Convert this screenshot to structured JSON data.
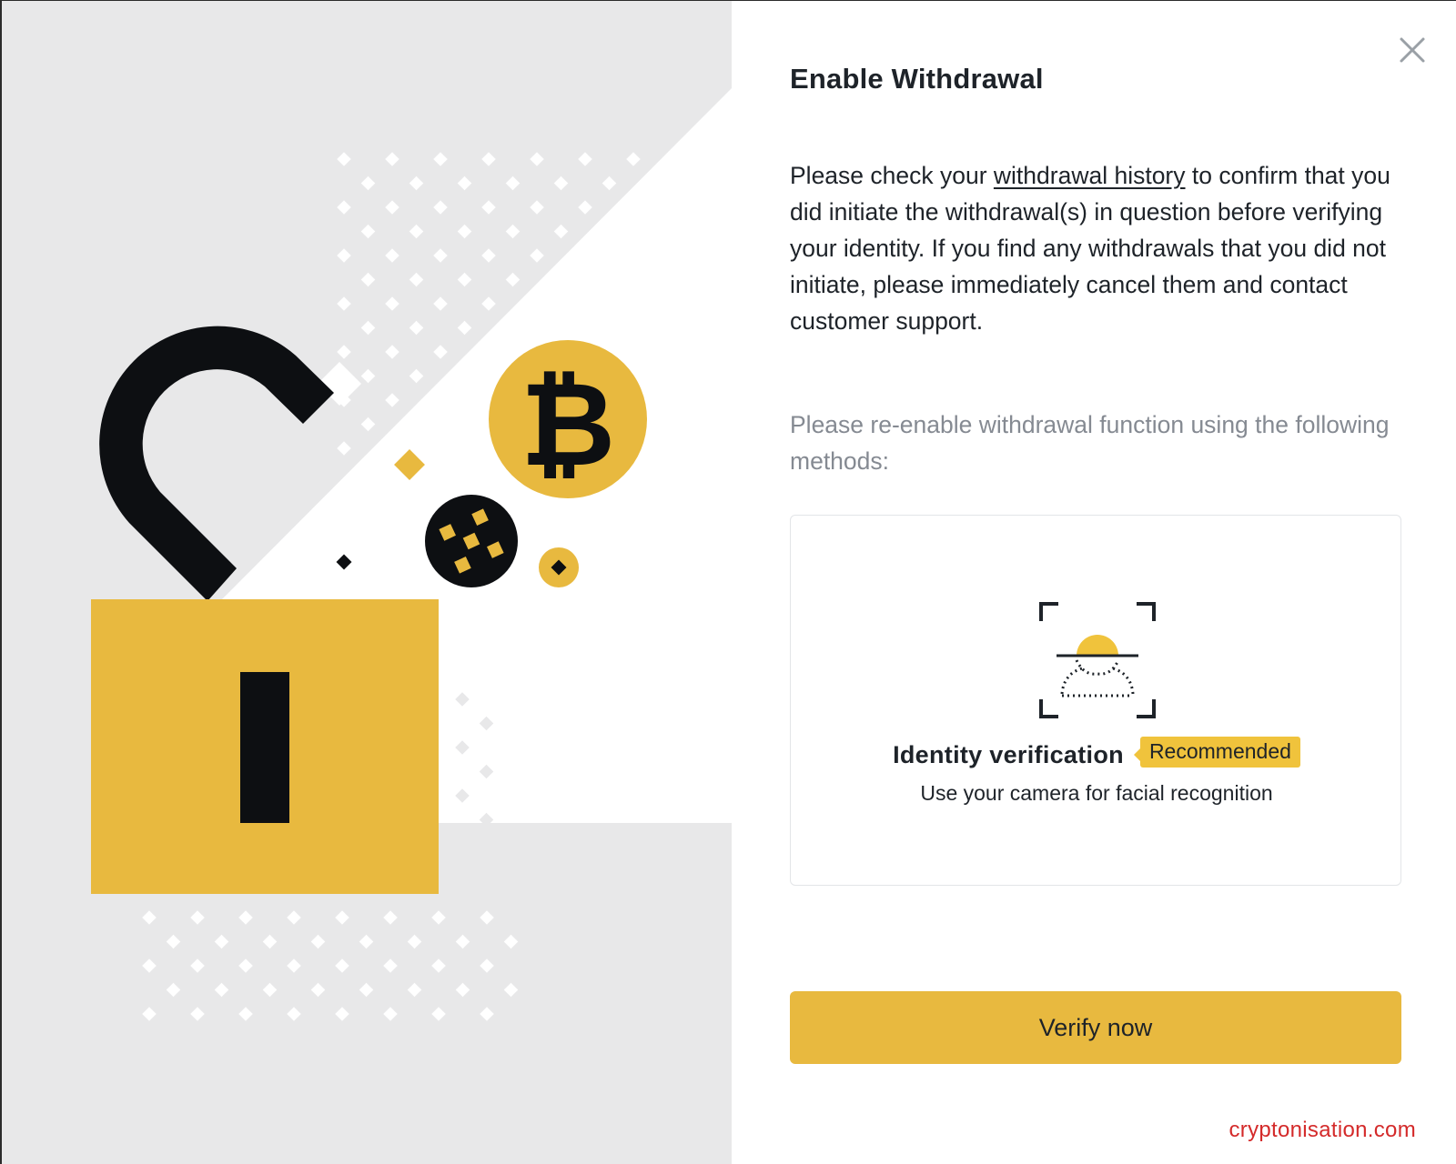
{
  "modal": {
    "title": "Enable Withdrawal",
    "close_icon": "close-icon"
  },
  "notice": {
    "before_link": "Please check your ",
    "link_text": "withdrawal history",
    "after_link": " to confirm that you did initiate the withdrawal(s) in question before verifying your identity. If you find any withdrawals that you did not initiate, please immediately cancel them and contact customer support."
  },
  "methods": {
    "intro": "Please re-enable withdrawal function using the following methods:",
    "items": [
      {
        "icon": "face-scan-icon",
        "title": "Identity verification",
        "badge": "Recommended",
        "description": "Use your camera for facial recognition"
      }
    ]
  },
  "verify_button": {
    "label": "Verify now"
  },
  "watermark": "cryptonisation.com",
  "illustration": {
    "icons": [
      "padlock-icon",
      "bitcoin-icon",
      "binance-icon"
    ]
  },
  "colors": {
    "accent": "#e8b93f",
    "badge": "#f0c33c",
    "text": "#1e2329",
    "muted": "#858a92",
    "illustration_bg": "#e8e8e9",
    "dark": "#0d0f12",
    "watermark": "#d42a2a"
  }
}
